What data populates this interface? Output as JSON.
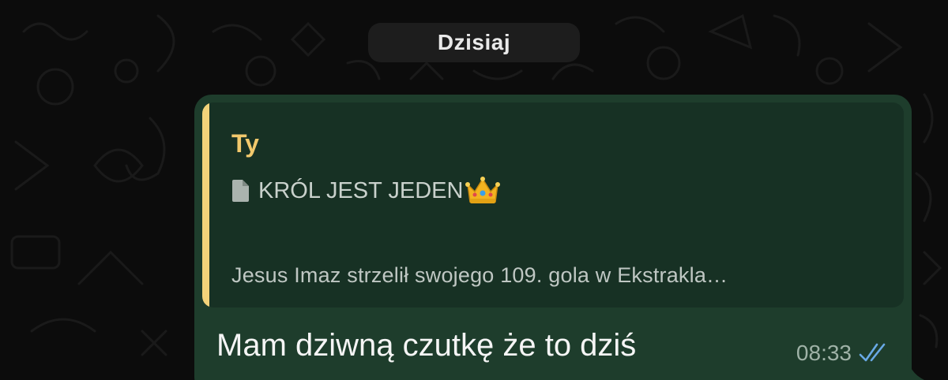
{
  "date_separator": "Dzisiaj",
  "message": {
    "reply": {
      "author": "Ty",
      "title": "KRÓL JEST JEDEN",
      "title_icon": "document-icon",
      "title_emoji": "crown-icon",
      "snippet": "Jesus Imaz strzelił swojego 109. gola w Ekstrakla…"
    },
    "text": "Mam dziwną czutkę że to dziś",
    "time": "08:33",
    "status_icon": "double-check-icon",
    "status": "read"
  },
  "colors": {
    "background": "#0c0c0c",
    "bubble": "#1e3d2c",
    "quote_background": "#173124",
    "quote_bar": "#f3d37a",
    "quote_author": "#f1c86c",
    "read_ticks": "#69a9e6"
  }
}
